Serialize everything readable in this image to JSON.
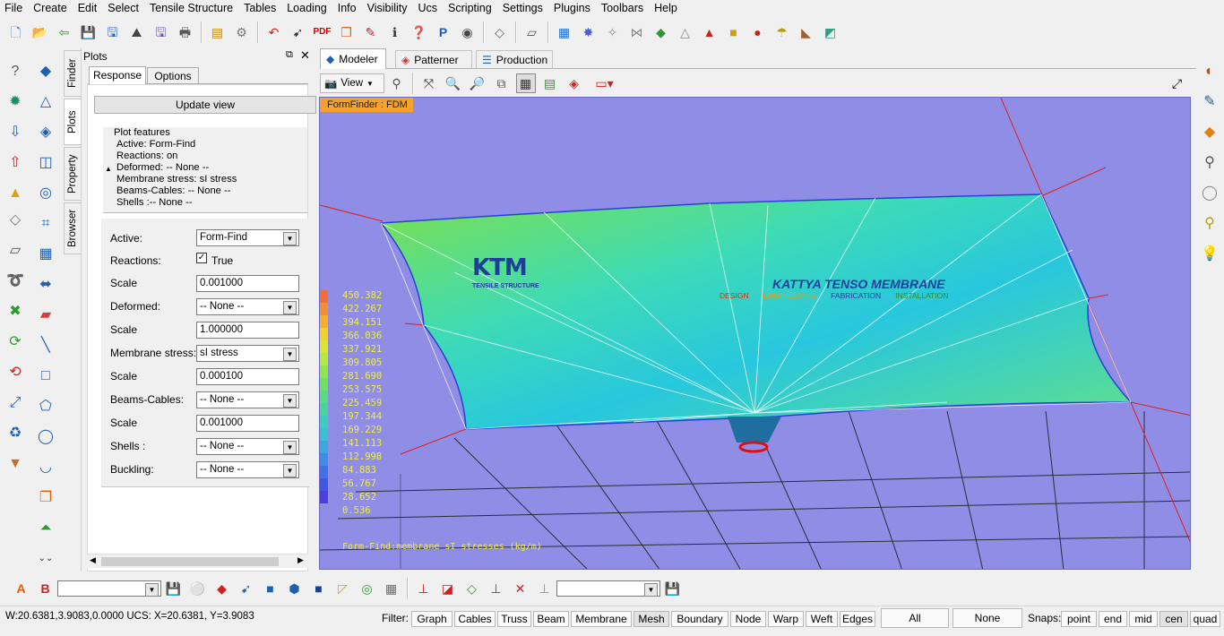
{
  "menu": [
    "File",
    "Create",
    "Edit",
    "Select",
    "Tensile Structure",
    "Tables",
    "Loading",
    "Info",
    "Visibility",
    "Ucs",
    "Scripting",
    "Settings",
    "Plugins",
    "Toolbars",
    "Help"
  ],
  "side_tabs": [
    "Finder",
    "Plots",
    "Property",
    "Browser"
  ],
  "plots": {
    "title": "Plots",
    "tabs": [
      "Response",
      "Options"
    ],
    "update_label": "Update view",
    "features_title": "Plot features",
    "features": [
      "Active: Form-Find",
      "Reactions: on",
      "Deformed: -- None --",
      "Membrane stress: sI  stress",
      "Beams-Cables: -- None --",
      "Shells :-- None --"
    ],
    "rows": [
      {
        "label": "Active:",
        "value": "Form-Find",
        "type": "select"
      },
      {
        "label": "Reactions:",
        "value": "True",
        "type": "checkbox"
      },
      {
        "label": "Scale",
        "value": "0.001000",
        "type": "input"
      },
      {
        "label": "Deformed:",
        "value": "-- None --",
        "type": "select"
      },
      {
        "label": "Scale",
        "value": "1.000000",
        "type": "input"
      },
      {
        "label": "Membrane stress:",
        "value": "sI  stress",
        "type": "select"
      },
      {
        "label": "Scale",
        "value": "0.000100",
        "type": "input"
      },
      {
        "label": "Beams-Cables:",
        "value": "-- None --",
        "type": "select"
      },
      {
        "label": "Scale",
        "value": "0.001000",
        "type": "input"
      },
      {
        "label": "Shells :",
        "value": "-- None --",
        "type": "select"
      },
      {
        "label": "Buckling:",
        "value": "-- None --",
        "type": "select"
      }
    ]
  },
  "view_tabs": [
    "Modeler",
    "Patterner",
    "Production"
  ],
  "view_label": "View",
  "viewport": {
    "badge": "FormFinder : FDM",
    "legend_values": [
      "450.382",
      "422.267",
      "394.151",
      "366.036",
      "337.921",
      "309.805",
      "281.690",
      "253.575",
      "225.459",
      "197.344",
      "169.229",
      "141.113",
      "112.998",
      "84.883",
      "56.767",
      "28.652",
      "0.536"
    ],
    "legend_colors": [
      "#f26f3a",
      "#f58d35",
      "#f7ae2e",
      "#f3d12a",
      "#dbe52e",
      "#b6ea3a",
      "#8fe647",
      "#6fe25d",
      "#58dc7c",
      "#48d59c",
      "#3dcdb8",
      "#39c3d0",
      "#3aa9de",
      "#3c8de4",
      "#3f72e6",
      "#4256e5",
      "#4a3fe0"
    ],
    "footer": "Form-Find:membrane sI stresses (kg/m)",
    "brand_title": "KATTYA TENSO MEMBRANE",
    "brand_items": [
      "DESIGN",
      "ENGINEERING",
      "FABRICATION",
      "INSTALLATION"
    ],
    "logo_text": "KTM",
    "logo_sub": "TENSILE STRUCTURE"
  },
  "status": {
    "coords": "W:20.6381,3.9083,0.0000   UCS: X=20.6381, Y=3.9083",
    "filter_label": "Filter:",
    "filters": [
      "Graph",
      "Cables",
      "Truss",
      "Beam",
      "Membrane",
      "Mesh",
      "Boundary",
      "Node",
      "Warp",
      "Weft",
      "Edges"
    ],
    "all_label": "All",
    "none_label": "None",
    "snaps_label": "Snaps:",
    "snaps": [
      "point",
      "end",
      "mid",
      "cen",
      "quad"
    ]
  }
}
